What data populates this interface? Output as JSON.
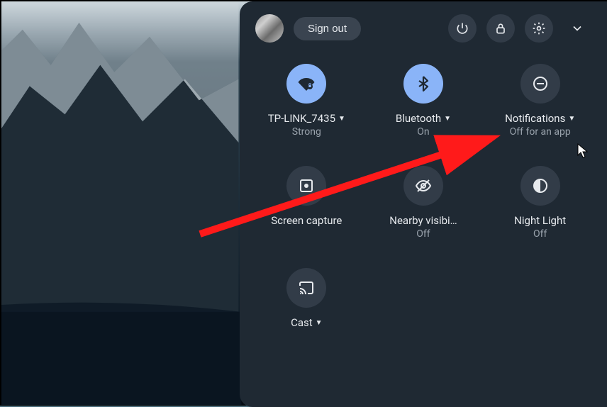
{
  "header": {
    "sign_out_label": "Sign out"
  },
  "tiles": {
    "wifi": {
      "label": "TP-LINK_7435",
      "sub": "Strong",
      "dropdown": true
    },
    "bluetooth": {
      "label": "Bluetooth",
      "sub": "On",
      "dropdown": true
    },
    "notifications": {
      "label": "Notifications",
      "sub": "Off for an app",
      "dropdown": true
    },
    "screen_capture": {
      "label": "Screen capture",
      "sub": ""
    },
    "nearby": {
      "label": "Nearby visibi…",
      "sub": "Off"
    },
    "night_light": {
      "label": "Night Light",
      "sub": "Off"
    },
    "cast": {
      "label": "Cast",
      "sub": "",
      "dropdown": true
    }
  },
  "annotation": {
    "arrow_color": "#ff1a1a"
  }
}
